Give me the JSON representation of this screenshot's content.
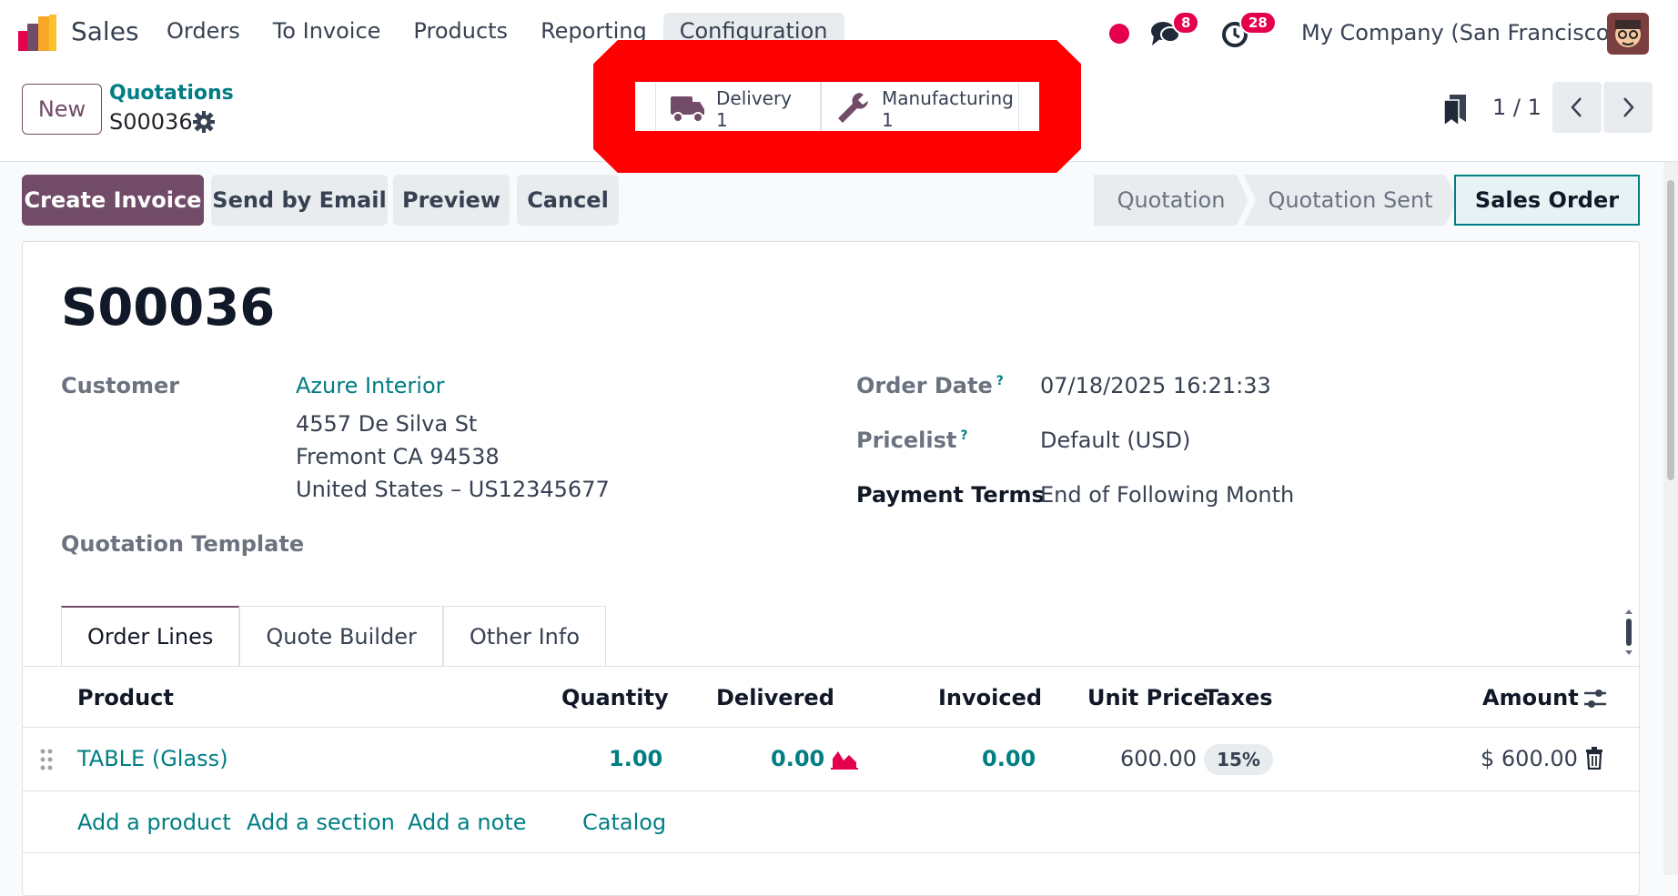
{
  "topbar": {
    "app_name": "Sales",
    "menu": [
      "Orders",
      "To Invoice",
      "Products",
      "Reporting",
      "Configuration"
    ],
    "active_menu": "Configuration",
    "messages_count": "8",
    "activities_count": "28",
    "company": "My Company (San Francisco)"
  },
  "control_panel": {
    "new_label": "New",
    "breadcrumb_parent": "Quotations",
    "breadcrumb_current": "S00036",
    "smart_buttons": [
      {
        "label": "Delivery",
        "value": "1",
        "icon": "truck-icon"
      },
      {
        "label": "Manufacturing",
        "value": "1",
        "icon": "wrench-icon"
      }
    ],
    "pager": "1 / 1"
  },
  "actions": {
    "create_invoice": "Create Invoice",
    "send_by_email": "Send by Email",
    "preview": "Preview",
    "cancel": "Cancel"
  },
  "statusbar": [
    "Quotation",
    "Quotation Sent",
    "Sales Order"
  ],
  "statusbar_current": "Sales Order",
  "form": {
    "title": "S00036",
    "customer_label": "Customer",
    "customer_name": "Azure Interior",
    "address_line1": "4557 De Silva St",
    "address_line2": "Fremont CA 94538",
    "address_line3": "United States – US12345677",
    "quotation_template_label": "Quotation Template",
    "order_date_label": "Order Date",
    "order_date_value": "07/18/2025 16:21:33",
    "pricelist_label": "Pricelist",
    "pricelist_value": "Default (USD)",
    "payment_terms_label": "Payment Terms",
    "payment_terms_value": "End of Following Month",
    "help_mark": "?"
  },
  "tabs": [
    "Order Lines",
    "Quote Builder",
    "Other Info"
  ],
  "table": {
    "columns": [
      "Product",
      "Quantity",
      "Delivered",
      "Invoiced",
      "Unit Price",
      "Taxes",
      "Amount"
    ],
    "rows": [
      {
        "product": "TABLE (Glass)",
        "quantity": "1.00",
        "delivered": "0.00",
        "invoiced": "0.00",
        "unit_price": "600.00",
        "taxes": "15%",
        "amount": "$ 600.00"
      }
    ],
    "add_links": [
      "Add a product",
      "Add a section",
      "Add a note",
      "Catalog"
    ]
  },
  "colors": {
    "brand": "#714b67",
    "link": "#017e84",
    "badge": "#e5004b",
    "highlight": "#ff0000"
  }
}
